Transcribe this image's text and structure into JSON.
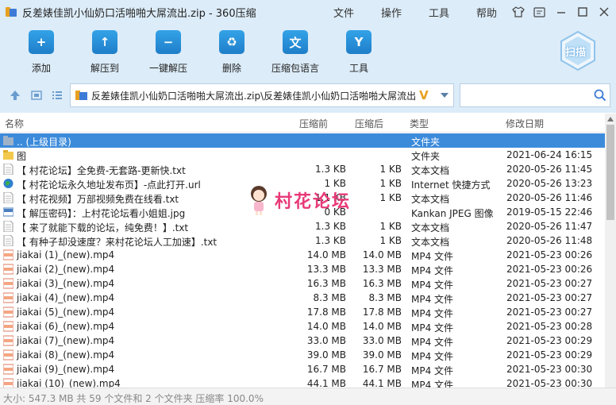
{
  "window": {
    "title": "反差婊佳凯小仙奶口活啪啪大屌流出.zip - 360压缩",
    "menus": [
      "文件",
      "操作",
      "工具",
      "帮助"
    ]
  },
  "toolbar": {
    "buttons": [
      {
        "label": "添加",
        "icon": "add-icon",
        "glyph": "+"
      },
      {
        "label": "解压到",
        "icon": "extract-to-icon",
        "glyph": "↑"
      },
      {
        "label": "一键解压",
        "icon": "one-click-extract-icon",
        "glyph": "−"
      },
      {
        "label": "删除",
        "icon": "trash-icon",
        "glyph": "♻"
      },
      {
        "label": "压缩包语言",
        "icon": "language-icon",
        "glyph": "文"
      },
      {
        "label": "工具",
        "icon": "tools-icon",
        "glyph": "Y"
      }
    ],
    "scan_label": "扫描"
  },
  "address": {
    "path": "反差婊佳凯小仙奶口活啪啪大屌流出.zip\\反差婊佳凯小仙奶口活啪啪大屌流出",
    "search_placeholder": ""
  },
  "columns": {
    "name": "名称",
    "size": "压缩前",
    "packed": "压缩后",
    "type": "类型",
    "date": "修改日期"
  },
  "files": [
    {
      "name": ".. (上级目录)",
      "size": "",
      "packed": "",
      "type": "文件夹",
      "date": "",
      "icon": "folder-up",
      "selected": true
    },
    {
      "name": "图",
      "size": "",
      "packed": "",
      "type": "文件夹",
      "date": "2021-06-24 16:15",
      "icon": "folder"
    },
    {
      "name": "【 村花论坛】全免费-无套路-更新快.txt",
      "size": "1.3 KB",
      "packed": "1 KB",
      "type": "文本文档",
      "date": "2020-05-26 11:45",
      "icon": "txt"
    },
    {
      "name": "【 村花论坛永久地址发布页】-点此打开.url",
      "size": "1 KB",
      "packed": "1 KB",
      "type": "Internet 快捷方式",
      "date": "2020-05-26 13:23",
      "icon": "url"
    },
    {
      "name": "【 村花视频】万部视频免费在线看.txt",
      "size": "1.1 KB",
      "packed": "1 KB",
      "type": "文本文档",
      "date": "2020-05-26 11:46",
      "icon": "txt"
    },
    {
      "name": "【 解压密码】：上村花论坛看小姐姐.jpg",
      "size": "0 KB",
      "packed": "",
      "type": "Kankan JPEG 图像",
      "date": "2019-05-15 22:46",
      "icon": "jpg"
    },
    {
      "name": "【 来了就能下载的论坛，纯免费！】.txt",
      "size": "1.3 KB",
      "packed": "1 KB",
      "type": "文本文档",
      "date": "2020-05-26 11:47",
      "icon": "txt"
    },
    {
      "name": "【 有种子却没速度？来村花论坛人工加速】.txt",
      "size": "1.3 KB",
      "packed": "1 KB",
      "type": "文本文档",
      "date": "2020-05-26 11:48",
      "icon": "txt"
    },
    {
      "name": "jiakai (1)_(new).mp4",
      "size": "14.0 MB",
      "packed": "14.0 MB",
      "type": "MP4 文件",
      "date": "2021-05-23 00:26",
      "icon": "mp4"
    },
    {
      "name": "jiakai (2)_(new).mp4",
      "size": "13.3 MB",
      "packed": "13.3 MB",
      "type": "MP4 文件",
      "date": "2021-05-23 00:26",
      "icon": "mp4"
    },
    {
      "name": "jiakai (3)_(new).mp4",
      "size": "16.3 MB",
      "packed": "16.3 MB",
      "type": "MP4 文件",
      "date": "2021-05-23 00:27",
      "icon": "mp4"
    },
    {
      "name": "jiakai (4)_(new).mp4",
      "size": "8.3 MB",
      "packed": "8.3 MB",
      "type": "MP4 文件",
      "date": "2021-05-23 00:27",
      "icon": "mp4"
    },
    {
      "name": "jiakai (5)_(new).mp4",
      "size": "17.8 MB",
      "packed": "17.8 MB",
      "type": "MP4 文件",
      "date": "2021-05-23 00:27",
      "icon": "mp4"
    },
    {
      "name": "jiakai (6)_(new).mp4",
      "size": "14.0 MB",
      "packed": "14.0 MB",
      "type": "MP4 文件",
      "date": "2021-05-23 00:28",
      "icon": "mp4"
    },
    {
      "name": "jiakai (7)_(new).mp4",
      "size": "33.0 MB",
      "packed": "33.0 MB",
      "type": "MP4 文件",
      "date": "2021-05-23 00:29",
      "icon": "mp4"
    },
    {
      "name": "jiakai (8)_(new).mp4",
      "size": "39.0 MB",
      "packed": "39.0 MB",
      "type": "MP4 文件",
      "date": "2021-05-23 00:29",
      "icon": "mp4"
    },
    {
      "name": "jiakai (9)_(new).mp4",
      "size": "16.7 MB",
      "packed": "16.7 MB",
      "type": "MP4 文件",
      "date": "2021-05-23 00:30",
      "icon": "mp4"
    },
    {
      "name": "jiakai (10)_(new).mp4",
      "size": "44.1 MB",
      "packed": "44.1 MB",
      "type": "MP4 文件",
      "date": "2021-05-23 00:30",
      "icon": "mp4"
    }
  ],
  "watermark": "村花论坛",
  "status": "大小: 547.3 MB 共 59 个文件和 2 个文件夹 压缩率 100.0%"
}
